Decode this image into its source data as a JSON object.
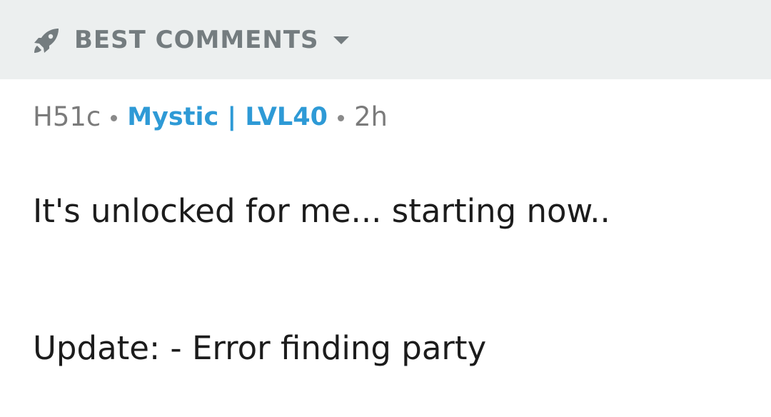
{
  "sort_bar": {
    "label": "BEST COMMENTS",
    "icon": "rocket-icon",
    "dropdown_icon": "caret-down-icon",
    "background": "#ecefef",
    "label_color": "#747c7f"
  },
  "comment": {
    "author": "H51c",
    "flair": "Mystic | LVL40",
    "age": "2h",
    "lines": [
      "It's unlocked for me... starting now..",
      "Update: - Error finding party"
    ],
    "flair_color": "#2e9ad6"
  }
}
